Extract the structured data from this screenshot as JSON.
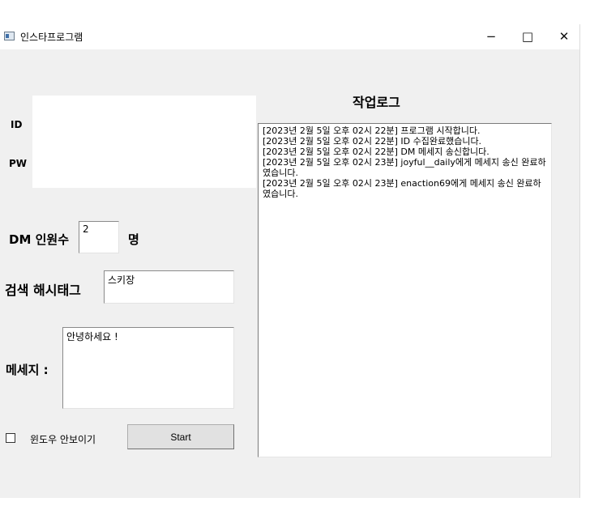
{
  "window": {
    "title": "인스타프로그램",
    "minimize_glyph": "−",
    "maximize_glyph": "□",
    "close_glyph": "✕",
    "icon": "app-window-icon"
  },
  "form": {
    "id_label": "ID",
    "pw_label": "PW",
    "dm_count_label": "DM 인원수",
    "dm_count_value": "2",
    "dm_count_unit": "명",
    "hashtag_label": "검색 해시태그",
    "hashtag_value": "스키장",
    "message_label": "메세지 :",
    "message_value": "안녕하세요 !",
    "hide_window_label": "윈도우 안보이기",
    "hide_window_checked": false,
    "start_button": "Start"
  },
  "log": {
    "title": "작업로그",
    "entries": [
      "[2023년 2월 5일 오후 02시 22분] 프로그램 시작합니다.",
      "[2023년 2월 5일 오후 02시 22분] ID 수집완료했습니다.",
      "[2023년 2월 5일 오후 02시 22분] DM 메세지 송신합니다.",
      "[2023년 2월 5일 오후 02시 23분] joyful__daily에게 메세지 송신 완료하였습니다.",
      "[2023년 2월 5일 오후 02시 23분] enaction69에게 메세지 송신 완료하였습니다."
    ]
  }
}
